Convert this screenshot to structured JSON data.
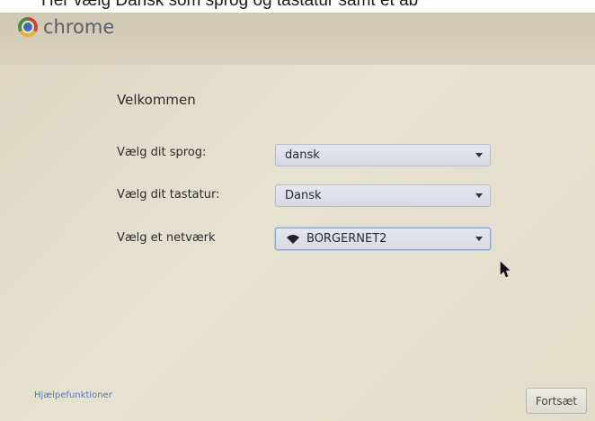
{
  "caption": {
    "text": "Her vælg Dansk som sprog og tastatur samt et ab"
  },
  "header": {
    "brand": "chrome",
    "logo_icon": "chrome-logo-icon"
  },
  "main": {
    "welcome": "Velkommen",
    "language": {
      "label": "Vælg dit sprog:",
      "value": "dansk"
    },
    "keyboard": {
      "label": "Vælg dit tastatur:",
      "value": "Dansk"
    },
    "network": {
      "label": "Vælg et netværk",
      "value": "BORGERNET2",
      "icon": "wifi-icon"
    }
  },
  "footer": {
    "help_link": "Hjælpefunktioner",
    "continue_label": "Fortsæt"
  },
  "colors": {
    "link": "#5579b8",
    "focus_border": "#8aa6d6"
  }
}
